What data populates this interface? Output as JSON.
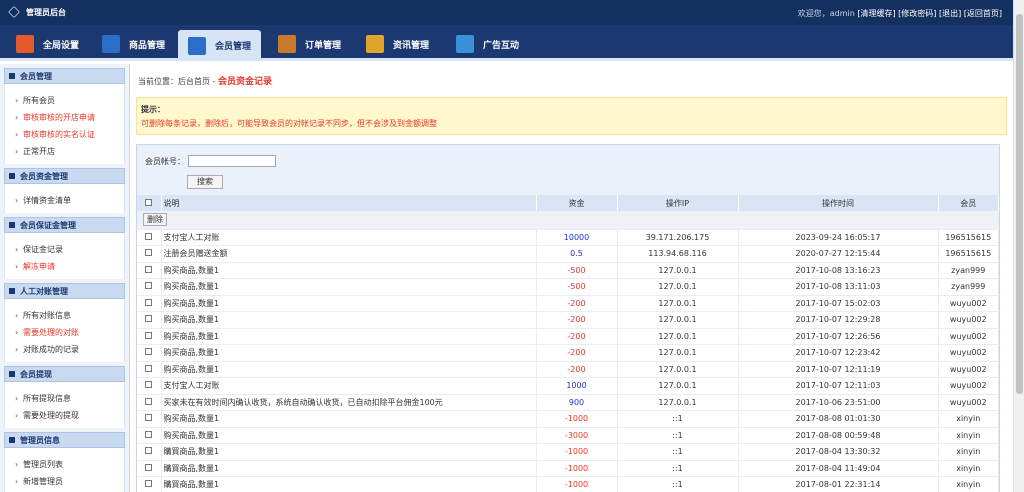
{
  "header": {
    "title": "管理员后台",
    "welcome": "欢迎您，admin",
    "links": [
      "[清理缓存]",
      "[修改密码]",
      "[退出]",
      "[返回首页]"
    ]
  },
  "tabs": [
    {
      "label": "全局设置",
      "icon": "home-icon",
      "color": "#e35b2a"
    },
    {
      "label": "商品管理",
      "icon": "grid-icon",
      "color": "#2a6fc7"
    },
    {
      "label": "会员管理",
      "icon": "members-icon",
      "color": "#2a6fc7",
      "active": true
    },
    {
      "label": "订单管理",
      "icon": "wallet-icon",
      "color": "#c9792c"
    },
    {
      "label": "资讯管理",
      "icon": "briefcase-icon",
      "color": "#e0a52a"
    },
    {
      "label": "广告互动",
      "icon": "monitor-icon",
      "color": "#3a90d9"
    }
  ],
  "sidebar": [
    {
      "title": "会员管理",
      "items": [
        {
          "label": "所有会员"
        },
        {
          "label": "审核审核的开店申请",
          "red": true
        },
        {
          "label": "审核审核的实名认证",
          "red": true
        },
        {
          "label": "正常开店"
        }
      ]
    },
    {
      "title": "会员资金管理",
      "items": [
        {
          "label": "详情资金清单"
        }
      ]
    },
    {
      "title": "会员保证金管理",
      "items": [
        {
          "label": "保证金记录"
        },
        {
          "label": "解冻申请",
          "red": true
        }
      ]
    },
    {
      "title": "人工对账管理",
      "items": [
        {
          "label": "所有对账信息"
        },
        {
          "label": "需要处理的对账",
          "red": true
        },
        {
          "label": "对账成功的记录"
        }
      ]
    },
    {
      "title": "会员提现",
      "items": [
        {
          "label": "所有提现信息"
        },
        {
          "label": "需要处理的提现"
        }
      ]
    },
    {
      "title": "管理员信息",
      "items": [
        {
          "label": "管理员列表"
        },
        {
          "label": "新增管理员"
        }
      ]
    }
  ],
  "breadcrumb": {
    "prefix": "当前位置：后台首页 -",
    "current": "会员资金记录"
  },
  "tip": {
    "title": "提示：",
    "text": "可删除每条记录，删除后，可能导致会员的对帐记录不同步，但不会涉及到金额调整"
  },
  "search": {
    "label": "会员帐号：",
    "value": "",
    "button": "搜索"
  },
  "table": {
    "headers": [
      "说明",
      "资金",
      "操作IP",
      "操作时间",
      "会员"
    ],
    "delete_label": "删除",
    "rows": [
      [
        "支付宝人工对账",
        "10000",
        "39.171.206.175",
        "2023-09-24 16:05:17",
        "196515615"
      ],
      [
        "注册会员赠送金额",
        "0.5",
        "113.94.68.116",
        "2020-07-27 12:15:44",
        "196515615"
      ],
      [
        "购买商品,数量1",
        "-500",
        "127.0.0.1",
        "2017-10-08 13:16:23",
        "zyan999"
      ],
      [
        "购买商品,数量1",
        "-500",
        "127.0.0.1",
        "2017-10-08 13:11:03",
        "zyan999"
      ],
      [
        "购买商品,数量1",
        "-200",
        "127.0.0.1",
        "2017-10-07 15:02:03",
        "wuyu002"
      ],
      [
        "购买商品,数量1",
        "-200",
        "127.0.0.1",
        "2017-10-07 12:29:28",
        "wuyu002"
      ],
      [
        "购买商品,数量1",
        "-200",
        "127.0.0.1",
        "2017-10-07 12:26:56",
        "wuyu002"
      ],
      [
        "购买商品,数量1",
        "-200",
        "127.0.0.1",
        "2017-10-07 12:23:42",
        "wuyu002"
      ],
      [
        "购买商品,数量1",
        "-200",
        "127.0.0.1",
        "2017-10-07 12:11:19",
        "wuyu002"
      ],
      [
        "支付宝人工对账",
        "1000",
        "127.0.0.1",
        "2017-10-07 12:11:03",
        "wuyu002"
      ],
      [
        "买家未在有效时间内确认收货，系统自动确认收货，已自动扣除平台佣金100元",
        "900",
        "127.0.0.1",
        "2017-10-06 23:51:00",
        "wuyu002"
      ],
      [
        "购买商品,数量1",
        "-1000",
        "::1",
        "2017-08-08 01:01:30",
        "xinyin"
      ],
      [
        "购买商品,数量1",
        "-3000",
        "::1",
        "2017-08-08 00:59:48",
        "xinyin"
      ],
      [
        "購買商品,數量1",
        "-1000",
        "::1",
        "2017-08-04 13:30:32",
        "xinyin"
      ],
      [
        "購買商品,數量1",
        "-1000",
        "::1",
        "2017-08-04 11:49:04",
        "xinyin"
      ],
      [
        "購買商品,數量1",
        "-1000",
        "::1",
        "2017-08-01 22:31:14",
        "xinyin"
      ]
    ]
  }
}
